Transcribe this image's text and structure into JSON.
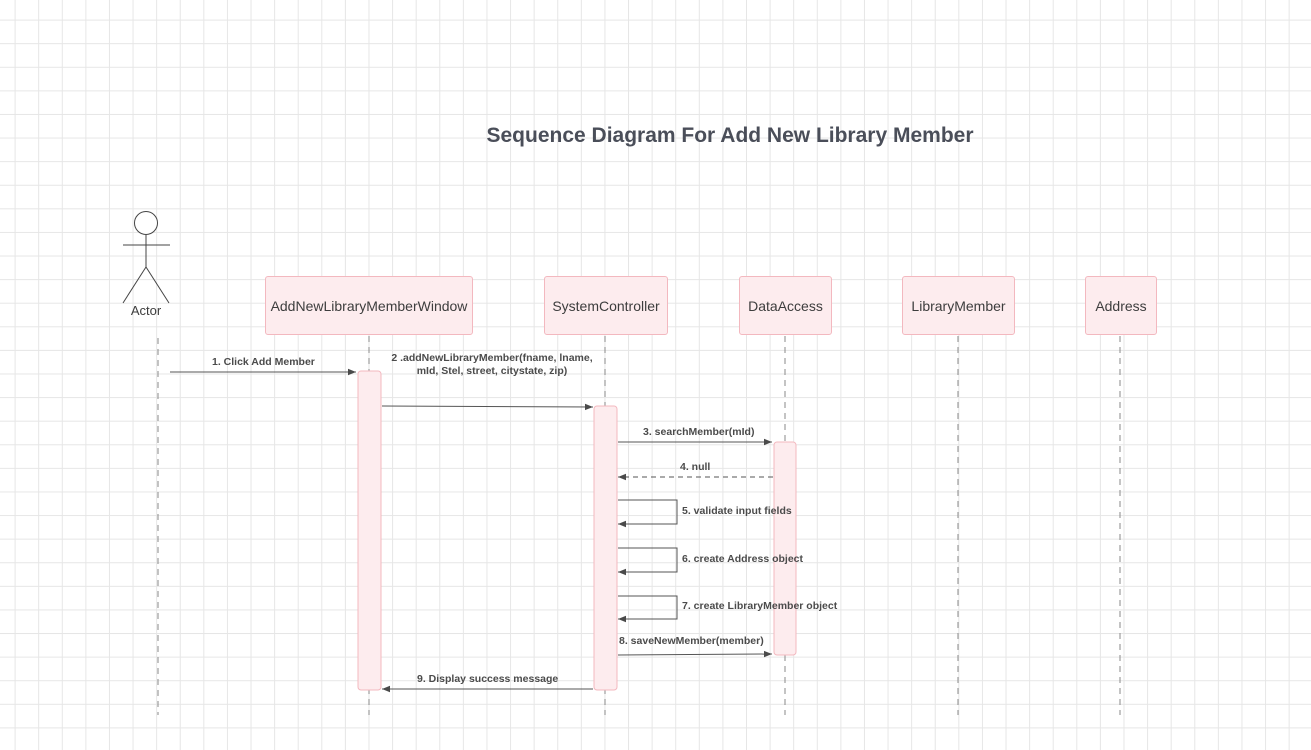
{
  "diagram": {
    "title": "Sequence Diagram For Add New Library Member",
    "actor": {
      "label": "Actor"
    },
    "lifelines": [
      {
        "id": "window",
        "label": "AddNewLibraryMemberWindow"
      },
      {
        "id": "controller",
        "label": "SystemController"
      },
      {
        "id": "dataaccess",
        "label": "DataAccess"
      },
      {
        "id": "librarymember",
        "label": "LibraryMember"
      },
      {
        "id": "address",
        "label": "Address"
      }
    ],
    "messages": [
      {
        "from": "actor",
        "to": "window",
        "label": "1. Click Add Member",
        "kind": "sync"
      },
      {
        "from": "window",
        "to": "controller",
        "label": "2 .addNewLibraryMember(fname, lname, mId, Stel, street,  citystate, zip)",
        "kind": "sync"
      },
      {
        "from": "controller",
        "to": "dataaccess",
        "label": "3. searchMember(mId)",
        "kind": "sync"
      },
      {
        "from": "dataaccess",
        "to": "controller",
        "label": "4. null",
        "kind": "return"
      },
      {
        "from": "controller",
        "to": "controller",
        "label": "5. validate input fields",
        "kind": "self"
      },
      {
        "from": "controller",
        "to": "controller",
        "label": "6. create Address object",
        "kind": "self"
      },
      {
        "from": "controller",
        "to": "controller",
        "label": "7. create LibraryMember object",
        "kind": "self"
      },
      {
        "from": "controller",
        "to": "dataaccess",
        "label": "8. saveNewMember(member)",
        "kind": "sync"
      },
      {
        "from": "controller",
        "to": "window",
        "label": "9. Display success message",
        "kind": "sync"
      }
    ],
    "colors": {
      "lifeline_fill": "#fdecee",
      "lifeline_border": "#f3b8bf",
      "line": "#555555",
      "dashed": "#8a8a8a"
    }
  }
}
